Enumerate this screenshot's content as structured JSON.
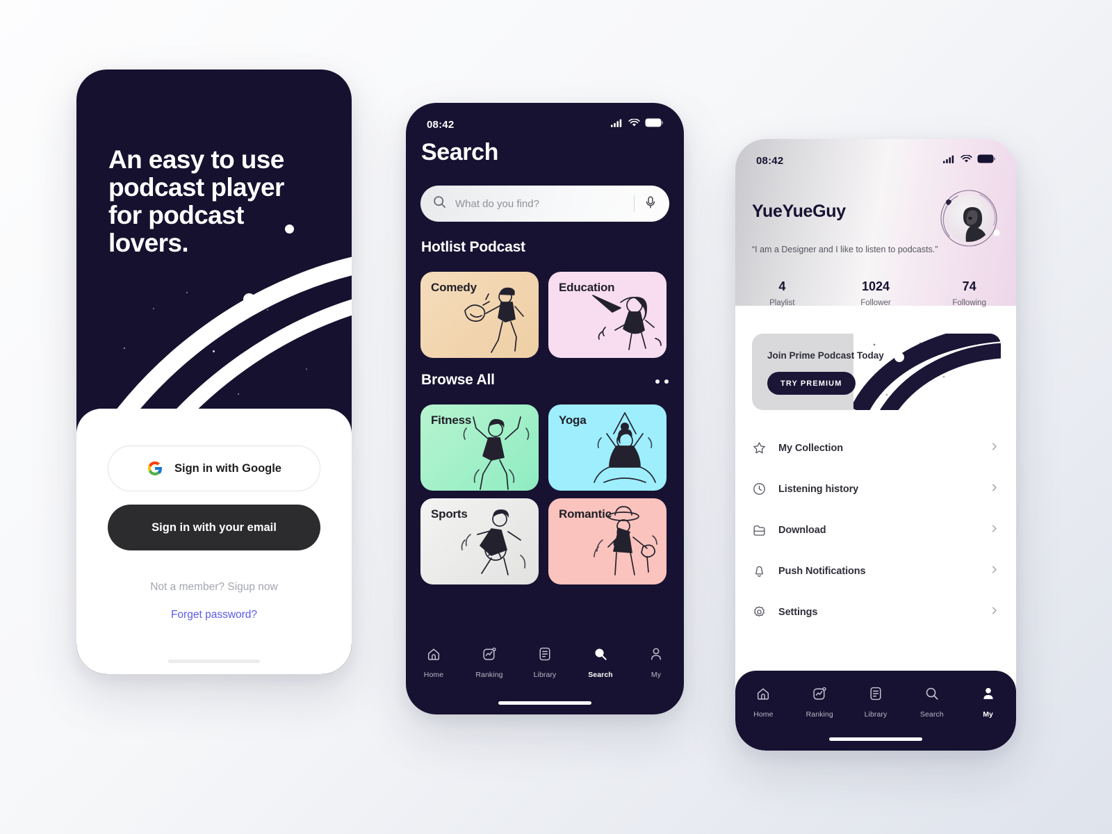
{
  "canvas": {
    "background_from": "#fdfdfe",
    "background_to": "#dfe3ec"
  },
  "theme": {
    "dark_navy": "#171231",
    "accent_blue": "#5a5aee",
    "button_dark": "#2c2c2e",
    "muted_text": "#a4a6b0"
  },
  "phone1": {
    "name": "onboarding-signin-screen",
    "headline": "An easy to use podcast player for podcast lovers.",
    "google_button": "Sign in with Google",
    "email_button": "Sign in with your email",
    "signup_text": "Not a member? Sigup now",
    "forgot_text": "Forget password?"
  },
  "phone2": {
    "name": "search-screen",
    "status": {
      "time": "08:42"
    },
    "title": "Search",
    "search": {
      "placeholder": "What do you find?",
      "value": ""
    },
    "sections": [
      {
        "title": "Hotlist Podcast",
        "has_more_dots": false
      },
      {
        "title": "Browse All",
        "has_more_dots": true
      }
    ],
    "hotlist": [
      {
        "label": "Comedy",
        "color": "#f2d5b1"
      },
      {
        "label": "Education",
        "color": "#f8dcf0"
      }
    ],
    "browse": [
      {
        "label": "Fitness",
        "color": "#9df0c8"
      },
      {
        "label": "Yoga",
        "color": "#9eeefe"
      },
      {
        "label": "Sports",
        "color": "#ececeb"
      },
      {
        "label": "Romantic",
        "color": "#fbc3bd"
      }
    ],
    "tabs": [
      {
        "label": "Home",
        "icon": "home-icon",
        "active": false
      },
      {
        "label": "Ranking",
        "icon": "ranking-icon",
        "active": false
      },
      {
        "label": "Library",
        "icon": "library-icon",
        "active": false
      },
      {
        "label": "Search",
        "icon": "search-icon",
        "active": true
      },
      {
        "label": "My",
        "icon": "person-icon",
        "active": false
      }
    ]
  },
  "phone3": {
    "name": "profile-screen",
    "status": {
      "time": "08:42"
    },
    "username": "YueYueGuy",
    "bio": "“I am a Designer and I like to listen to podcasts.”",
    "stats": [
      {
        "number": "4",
        "label": "Playlist"
      },
      {
        "number": "1024",
        "label": "Follower"
      },
      {
        "number": "74",
        "label": "Following"
      }
    ],
    "banner": {
      "title": "Join Prime Podcast Today",
      "button": "TRY  PREMIUM"
    },
    "menu": [
      {
        "label": "My Collection",
        "icon": "star-icon"
      },
      {
        "label": "Listening history",
        "icon": "clock-icon"
      },
      {
        "label": "Download",
        "icon": "folder-icon"
      },
      {
        "label": "Push Notifications",
        "icon": "bell-icon"
      },
      {
        "label": "Settings",
        "icon": "gear-icon"
      }
    ],
    "tabs": [
      {
        "label": "Home",
        "icon": "home-icon",
        "active": false
      },
      {
        "label": "Ranking",
        "icon": "ranking-icon",
        "active": false
      },
      {
        "label": "Library",
        "icon": "library-icon",
        "active": false
      },
      {
        "label": "Search",
        "icon": "search-icon",
        "active": false
      },
      {
        "label": "My",
        "icon": "person-icon",
        "active": true
      }
    ]
  }
}
